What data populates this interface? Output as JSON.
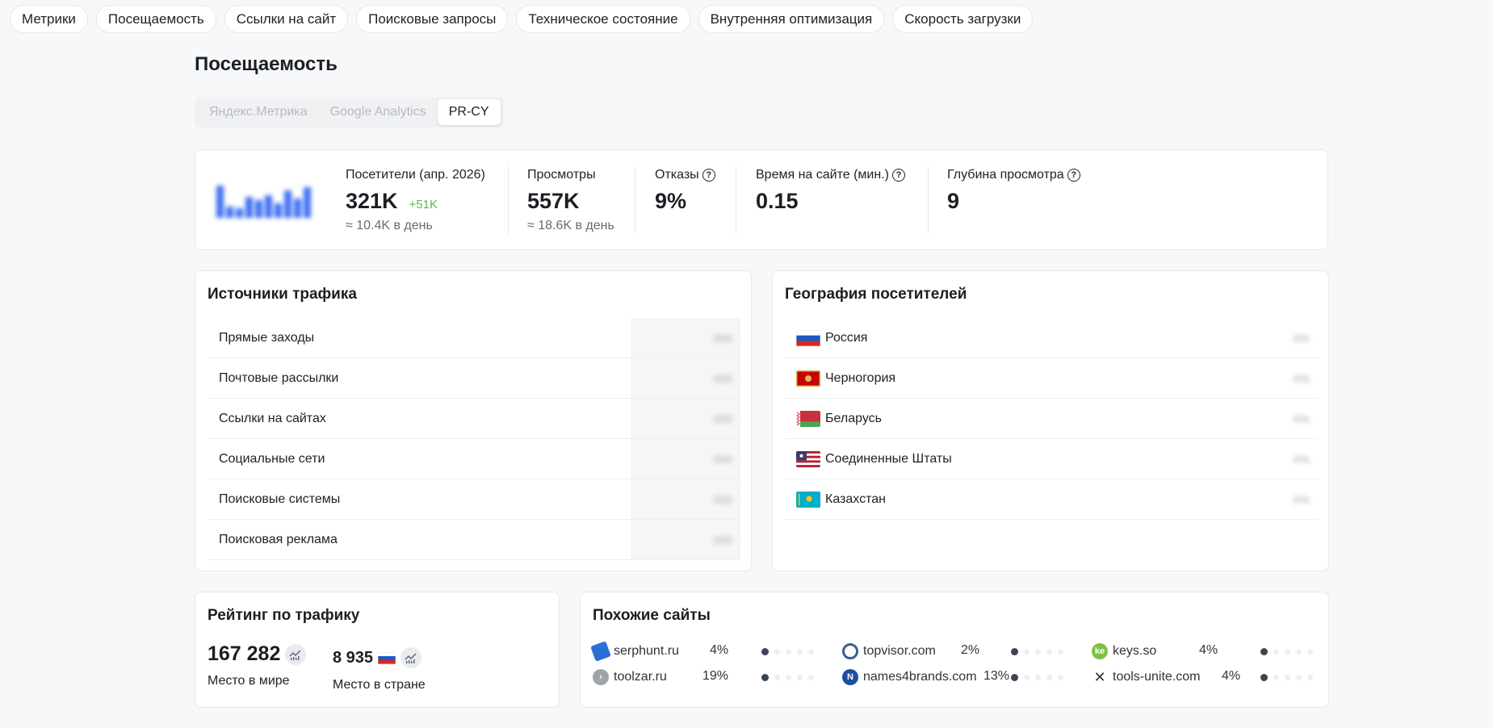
{
  "topnav": [
    "Метрики",
    "Посещаемость",
    "Ссылки на сайт",
    "Поисковые запросы",
    "Техническое состояние",
    "Внутренняя оптимизация",
    "Скорость загрузки"
  ],
  "page_title": "Посещаемость",
  "tabs": [
    {
      "label": "Яндекс.Метрика",
      "active": false
    },
    {
      "label": "Google Analytics",
      "active": false
    },
    {
      "label": "PR-CY",
      "active": true
    }
  ],
  "stats": {
    "visitors": {
      "label": "Посетители (апр. 2026)",
      "value": "321K",
      "delta": "+51K",
      "sub": "≈ 10.4K в день"
    },
    "views": {
      "label": "Просмотры",
      "value": "557K",
      "sub": "≈ 18.6K в день"
    },
    "bounce": {
      "label": "Отказы",
      "value": "9%"
    },
    "time": {
      "label": "Время на сайте (мин.)",
      "value": "0.15"
    },
    "depth": {
      "label": "Глубина просмотра",
      "value": "9"
    }
  },
  "traffic": {
    "title": "Источники трафика",
    "rows": [
      {
        "label": "Прямые заходы",
        "value": "000"
      },
      {
        "label": "Почтовые рассылки",
        "value": "000"
      },
      {
        "label": "Ссылки на сайтах",
        "value": "000"
      },
      {
        "label": "Социальные сети",
        "value": "000"
      },
      {
        "label": "Поисковые системы",
        "value": "000"
      },
      {
        "label": "Поисковая реклама",
        "value": "000"
      }
    ]
  },
  "geo": {
    "title": "География посетителей",
    "rows": [
      {
        "label": "Россия",
        "value": "0%",
        "flag": "russia-flag-icon"
      },
      {
        "label": "Черногория",
        "value": "0%",
        "flag": "montenegro-flag-icon"
      },
      {
        "label": "Беларусь",
        "value": "0%",
        "flag": "belarus-flag-icon"
      },
      {
        "label": "Соединенные Штаты",
        "value": "0%",
        "flag": "usa-flag-icon"
      },
      {
        "label": "Казахстан",
        "value": "0%",
        "flag": "kazakhstan-flag-icon"
      }
    ]
  },
  "rating": {
    "title": "Рейтинг по трафику",
    "world": {
      "value": "167 282",
      "label": "Место в мире"
    },
    "country": {
      "value": "8 935",
      "label": "Место в стране"
    }
  },
  "similar": {
    "title": "Похожие сайты",
    "sites": [
      {
        "name": "serphunt.ru",
        "pct": "4%",
        "level": 1,
        "icon": "serphunt-icon",
        "color": "#2b6fd6"
      },
      {
        "name": "topvisor.com",
        "pct": "2%",
        "level": 1,
        "icon": "topvisor-icon",
        "color": "#3a5f8c"
      },
      {
        "name": "keys.so",
        "pct": "4%",
        "level": 1,
        "icon": "keys-so-icon",
        "color": "#7cc246"
      },
      {
        "name": "toolzar.ru",
        "pct": "19%",
        "level": 1,
        "icon": "toolzar-icon",
        "color": "#a0a4aa"
      },
      {
        "name": "names4brands.com",
        "pct": "13%",
        "level": 1,
        "icon": "names4brands-icon",
        "color": "#1e4fa3"
      },
      {
        "name": "tools-unite.com",
        "pct": "4%",
        "level": 1,
        "icon": "tools-unite-icon",
        "color": "#2c3540"
      }
    ]
  },
  "colors": {
    "accent_green": "#5bb84c",
    "spark_blue": "#3d6ef0",
    "dot_on": "#3a4654"
  }
}
